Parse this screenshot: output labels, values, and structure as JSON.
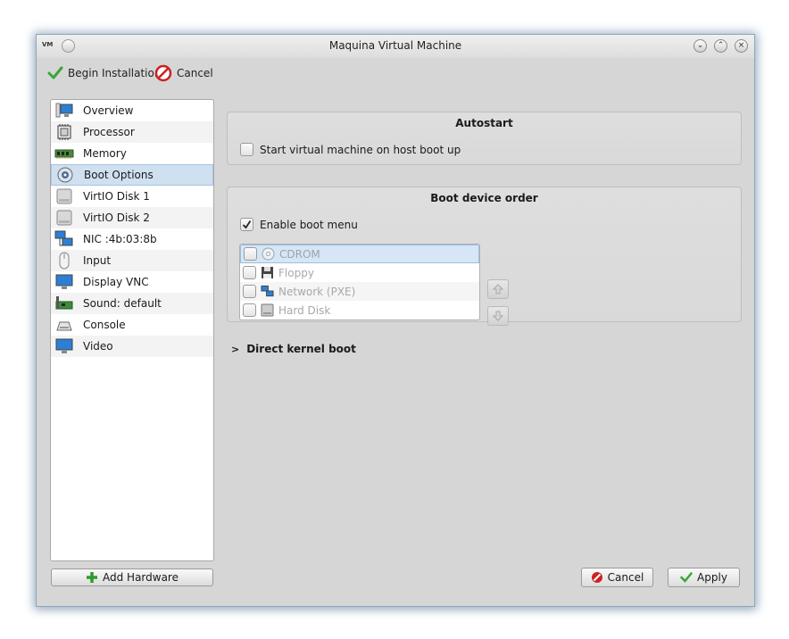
{
  "window": {
    "title": "Maquina Virtual Machine",
    "app_icon_label": "VM"
  },
  "toolbar": {
    "begin_label": "Begin Installation",
    "cancel_label": "Cancel"
  },
  "sidebar": {
    "items": [
      {
        "label": "Overview",
        "icon": "monitor-icon"
      },
      {
        "label": "Processor",
        "icon": "cpu-icon"
      },
      {
        "label": "Memory",
        "icon": "memory-icon"
      },
      {
        "label": "Boot Options",
        "icon": "boot-options-icon"
      },
      {
        "label": "VirtIO Disk 1",
        "icon": "disk-icon"
      },
      {
        "label": "VirtIO Disk 2",
        "icon": "disk-icon"
      },
      {
        "label": "NIC :4b:03:8b",
        "icon": "network-icon"
      },
      {
        "label": "Input",
        "icon": "mouse-icon"
      },
      {
        "label": "Display VNC",
        "icon": "display-icon"
      },
      {
        "label": "Sound: default",
        "icon": "sound-card-icon"
      },
      {
        "label": "Console",
        "icon": "console-icon"
      },
      {
        "label": "Video",
        "icon": "video-icon"
      }
    ],
    "selected": "Boot Options",
    "add_hardware_label": "Add Hardware"
  },
  "autostart": {
    "title": "Autostart",
    "checkbox_label": "Start virtual machine on host boot up",
    "checked": false
  },
  "boot_order": {
    "title": "Boot device order",
    "enable_menu_label": "Enable boot menu",
    "enable_menu_checked": true,
    "devices": [
      {
        "label": "CDROM",
        "icon": "cdrom-icon",
        "checked": false
      },
      {
        "label": "Floppy",
        "icon": "floppy-icon",
        "checked": false
      },
      {
        "label": "Network (PXE)",
        "icon": "network-icon",
        "checked": false
      },
      {
        "label": "Hard Disk",
        "icon": "hard-disk-icon",
        "checked": false
      }
    ]
  },
  "direct_kernel": {
    "label": "Direct kernel boot",
    "expanded": false
  },
  "footer": {
    "cancel_label": "Cancel",
    "apply_label": "Apply"
  },
  "colors": {
    "accent": "#cfe0f1",
    "window_bg": "#d6d6d6",
    "cancel_red": "#cc2222",
    "apply_green": "#3aa53a"
  }
}
